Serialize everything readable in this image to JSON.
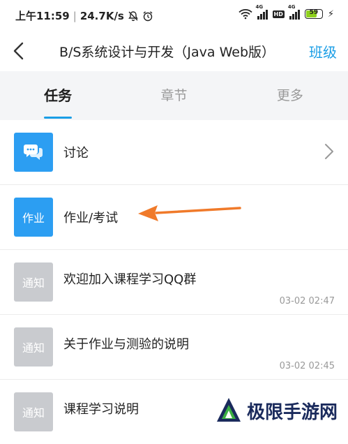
{
  "status_bar": {
    "time": "上午11:59",
    "speed": "24.7K/s",
    "signal1_label": "4G",
    "signal2_label": "4G",
    "hd_label": "HD",
    "battery": "59"
  },
  "navbar": {
    "title": "B/S系统设计与开发（Java Web版）",
    "right_label": "班级"
  },
  "tabs": [
    {
      "label": "任务",
      "active": true
    },
    {
      "label": "章节",
      "active": false
    },
    {
      "label": "更多",
      "active": false
    }
  ],
  "items": [
    {
      "icon": "chat-bubbles-icon",
      "icon_text": "",
      "label": "讨论",
      "time": ""
    },
    {
      "icon": "homework-icon",
      "icon_text": "作业",
      "label": "作业/考试",
      "time": ""
    },
    {
      "icon": "notice-icon",
      "icon_text": "通知",
      "label": "欢迎加入课程学习QQ群",
      "time": "03-02 02:47"
    },
    {
      "icon": "notice-icon",
      "icon_text": "通知",
      "label": "关于作业与测验的说明",
      "time": "03-02 02:45"
    },
    {
      "icon": "notice-icon",
      "icon_text": "通知",
      "label": "课程学习说明",
      "time": ""
    }
  ],
  "watermark": {
    "text": "极限手游网"
  },
  "colors": {
    "accent": "#1a9ee6",
    "icon_blue": "#2c9ef2",
    "icon_gray": "#c9cbcf",
    "arrow": "#f07a2a"
  }
}
